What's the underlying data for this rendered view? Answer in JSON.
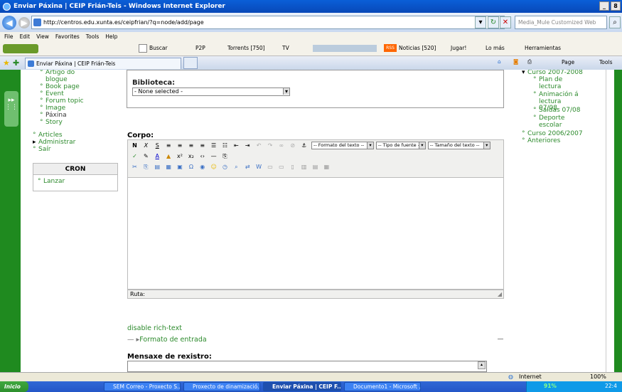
{
  "window": {
    "title": "Enviar Páxina | CEIP Frián-Teis - Windows Internet Explorer",
    "controls": [
      "_",
      "8"
    ]
  },
  "address": {
    "url": "http://centros.edu.xunta.es/ceipfrian/?q=node/add/page",
    "search_placeholder": "Media_Mule Customized Web Search"
  },
  "menu": [
    "File",
    "Edit",
    "View",
    "Favorites",
    "Tools",
    "Help"
  ],
  "toolbar": {
    "buscar": "Buscar",
    "p2p": "P2P",
    "torrents": "Torrents [750]",
    "tv": "TV",
    "noticias": "Noticias [520]",
    "jugar": "Jugar!",
    "lomas": "Lo más",
    "herramientas": "Herramientas"
  },
  "tab": {
    "label": "Enviar Páxina | CEIP Frián-Teis",
    "page": "Page",
    "tools": "Tools"
  },
  "left_nav": {
    "items": [
      "Artigo do blogue",
      "Book page",
      "Event",
      "Forum topic",
      "Image",
      "Páxina",
      "Story"
    ],
    "articles": "Articles",
    "administrar": "Administrar",
    "sair": "Saír",
    "cron_title": "CRON",
    "lanzar": "Lanzar"
  },
  "form": {
    "biblioteca_label": "Biblioteca:",
    "biblioteca_value": "- None selected -",
    "corpo_label": "Corpo:",
    "formato_texto": "-- Formato del texto --",
    "tipo_fuente": "-- Tipo de fuente --",
    "tamano_texto": "-- Tamaño del texto --",
    "ruta": "Ruta:",
    "disable_rich": "disable rich-text",
    "formato_entrada": "Formato de entrada",
    "mensaxe_label": "Mensaxe de rexistro:"
  },
  "right_nav": {
    "curso_2007": "Curso 2007-2008",
    "items": [
      "Plan de lectura",
      "Animación á lectura 07/08",
      "Saídas 07/08",
      "Deporte escolar"
    ],
    "curso_2006": "Curso 2006/2007",
    "anteriores": "Anteriores"
  },
  "status": {
    "zone": "Internet",
    "zoom": "100%"
  },
  "taskbar": {
    "start": "Inicio",
    "items": [
      "SEM Correo - Proxecto S...",
      "Proxecto de dinamizació...",
      "Enviar Páxina | CEIP F...",
      "Documento1 - Microsoft ..."
    ],
    "battery": "91%",
    "clock": "22:4"
  },
  "colors": {
    "accent_green": "#1f8a1f",
    "link_green": "#2c8a2c"
  }
}
